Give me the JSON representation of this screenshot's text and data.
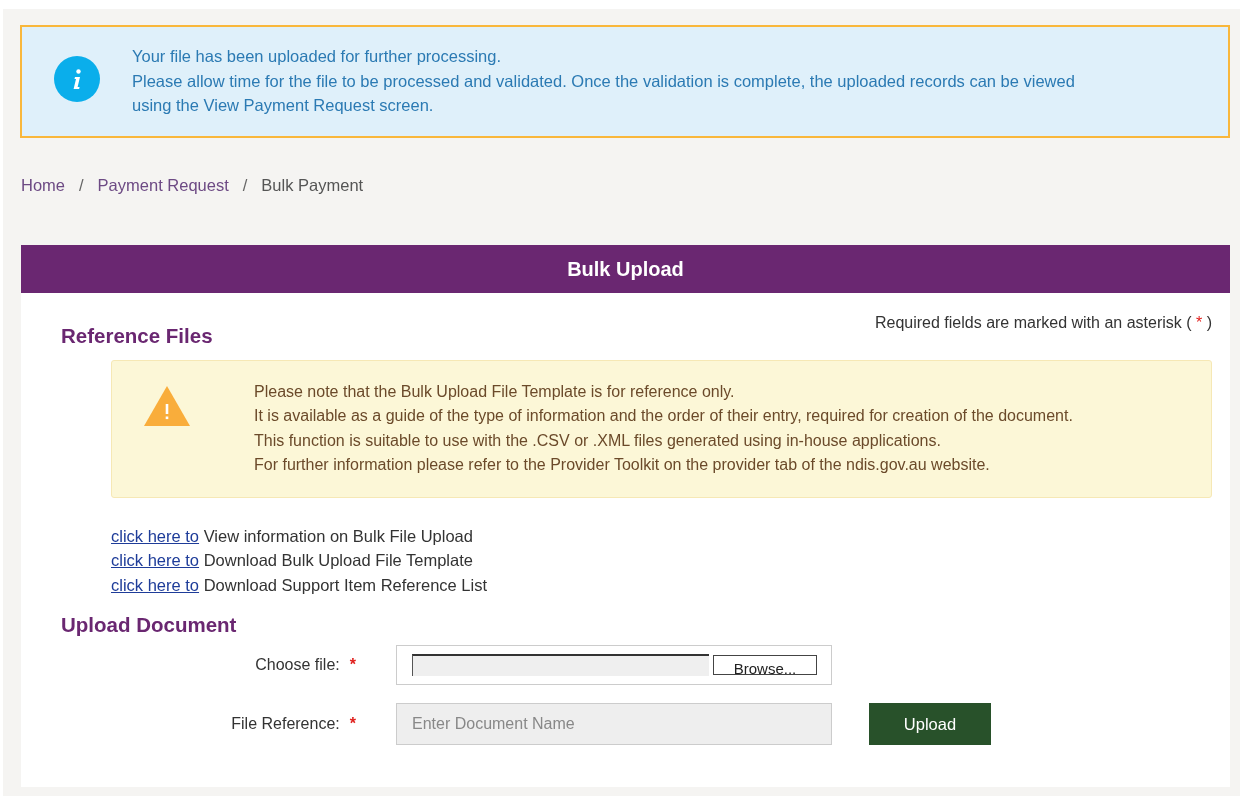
{
  "alert": {
    "lines": [
      "Your file has been uploaded for further processing.",
      "Please allow time for the file to be processed and validated. Once the validation is complete, the uploaded records can be viewed",
      "using the View Payment Request screen."
    ]
  },
  "breadcrumb": [
    {
      "label": "Home",
      "kind": "link"
    },
    {
      "label": "Payment Request",
      "kind": "link"
    },
    {
      "label": "Bulk Payment",
      "kind": "current"
    }
  ],
  "breadcrumb_separator": "/",
  "panel": {
    "title": "Bulk Upload",
    "required_note": {
      "before": "Required fields are marked with an asterisk (",
      "asterisk": "*",
      "after": ")"
    },
    "reference_section": {
      "title": "Reference Files",
      "warning_lines": [
        "Please note that the Bulk Upload File Template is for reference only.",
        "It is available as a guide of the type of information and the order of their entry, required for creation of the document.",
        "This function is suitable to use with the .CSV or .XML files generated using in-house applications.",
        "For further information please refer to the Provider Toolkit on the provider tab of the ndis.gov.au website."
      ],
      "links": [
        {
          "link": "click here to",
          "text": "View information on Bulk File Upload"
        },
        {
          "link": "click here to",
          "text": "Download Bulk Upload File Template"
        },
        {
          "link": "click here to",
          "text": "Download Support Item Reference List"
        }
      ]
    },
    "upload_section": {
      "title": "Upload Document",
      "fields": [
        {
          "kind": "file",
          "label": "Choose file:",
          "required": true,
          "button": "Browse..."
        },
        {
          "kind": "text",
          "label": "File Reference:",
          "required": true,
          "placeholder": "Enter Document Name",
          "action": "Upload"
        }
      ]
    }
  }
}
